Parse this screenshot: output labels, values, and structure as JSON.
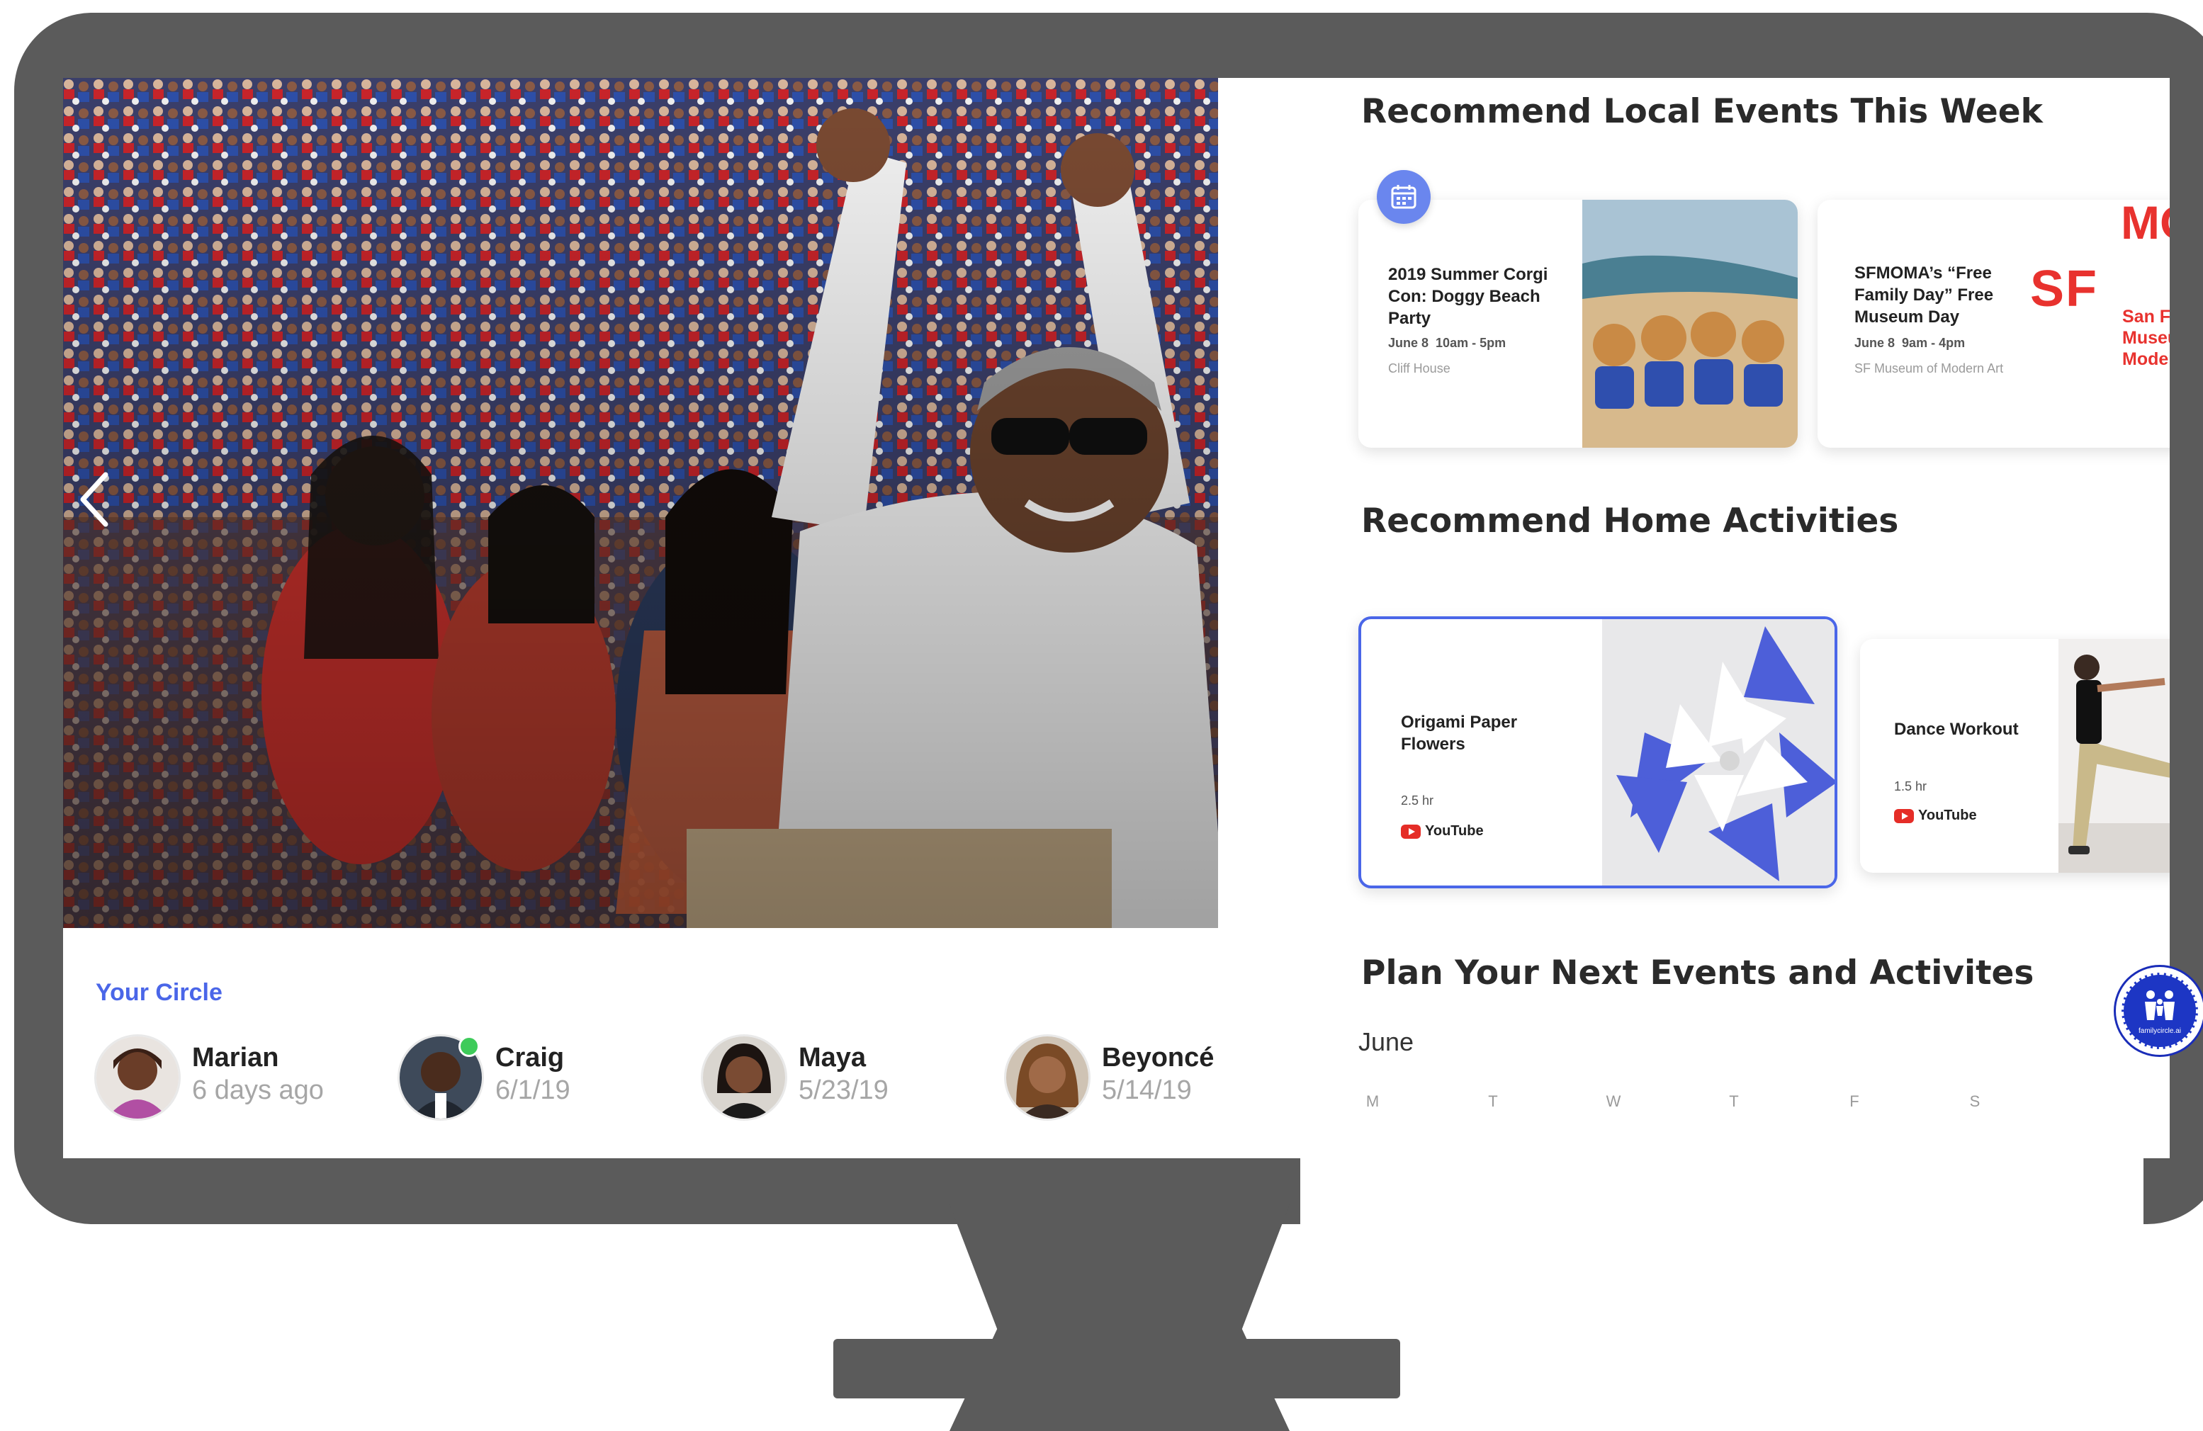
{
  "circle": {
    "title": "Your Circle",
    "members": [
      {
        "name": "Marian",
        "date": "6 days ago",
        "online": false
      },
      {
        "name": "Craig",
        "date": "6/1/19",
        "online": true
      },
      {
        "name": "Maya",
        "date": "5/23/19",
        "online": false
      },
      {
        "name": "Beyoncé",
        "date": "5/14/19",
        "online": false
      }
    ]
  },
  "local_events": {
    "title": "Recommend Local Events This Week",
    "cards": [
      {
        "title": "2019 Summer Corgi Con: Doggy Beach Party",
        "date": "June 8",
        "time": "10am - 5pm",
        "location": "Cliff House"
      },
      {
        "title": "SFMOMA’s “Free Family Day” Free Museum Day",
        "date": "June 8",
        "time": "9am - 4pm",
        "location": "SF Museum of Modern Art",
        "logo_text": "SF",
        "logo_top": "MO",
        "logo_lines": [
          "San Fra",
          "Museu",
          "Moder"
        ]
      }
    ]
  },
  "home_activities": {
    "title": "Recommend Home Activities",
    "cards": [
      {
        "title": "Origami Paper Flowers",
        "duration": "2.5 hr",
        "source": "YouTube"
      },
      {
        "title": "Dance Workout",
        "duration": "1.5 hr",
        "source": "YouTube"
      }
    ]
  },
  "planner": {
    "title": "Plan Your Next Events and Activites",
    "month": "June",
    "weekdays": [
      "M",
      "T",
      "W",
      "T",
      "F",
      "S"
    ]
  },
  "brand": {
    "name": "familycircle.ai"
  },
  "icons": [
    "chevron-left-icon",
    "chevron-right-icon",
    "calendar-icon",
    "youtube-icon",
    "family-logo-icon"
  ],
  "colors": {
    "accent": "#4a66e8",
    "bezel": "#5b5b5b",
    "online": "#3ecb5a",
    "sfmoma_red": "#e8322e",
    "youtube_red": "#e52d27",
    "brand_blue": "#1d36c4"
  }
}
